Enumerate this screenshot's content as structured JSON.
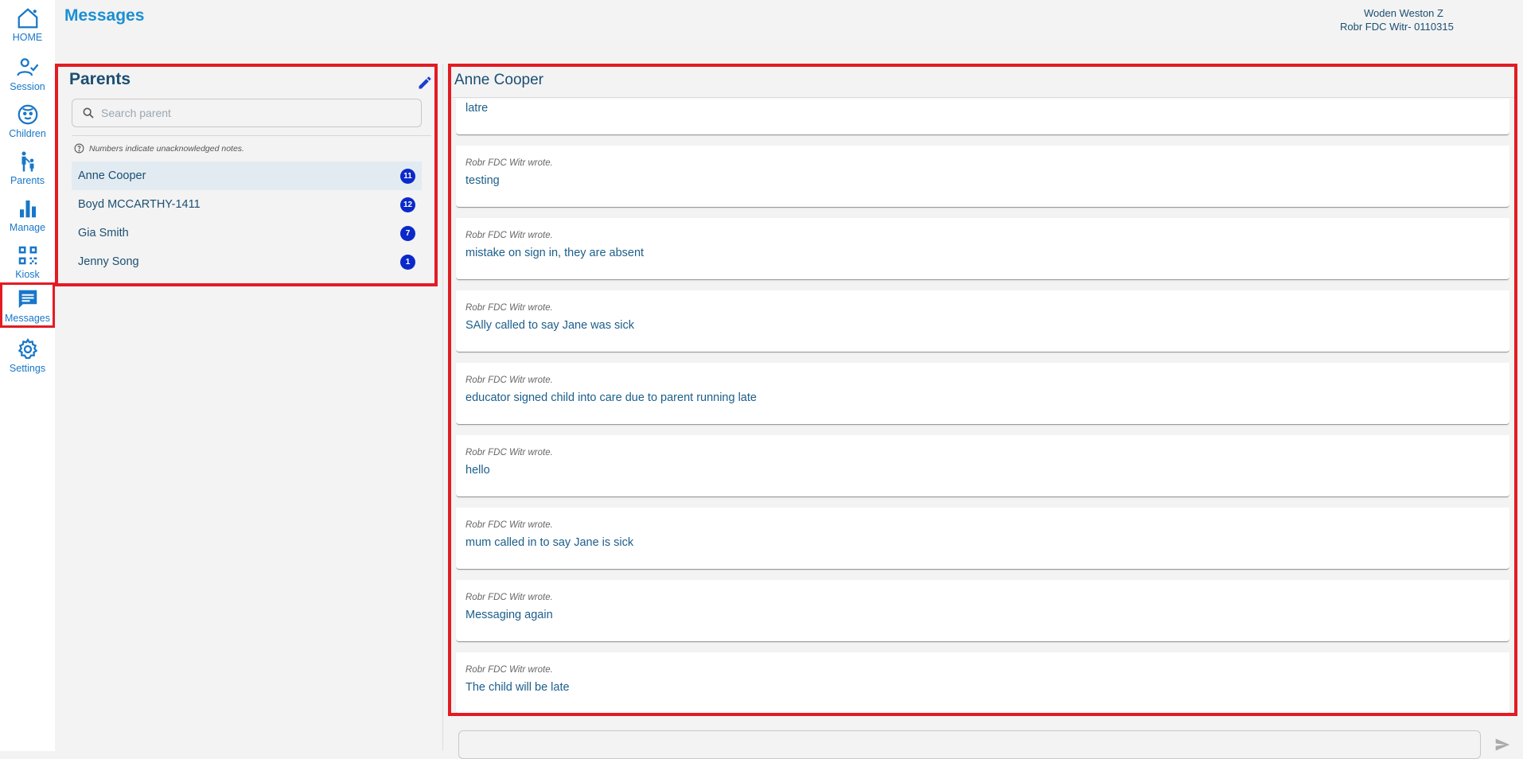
{
  "nav": [
    {
      "key": "home",
      "label": "HOME",
      "icon": "home-icon"
    },
    {
      "key": "session",
      "label": "Session",
      "icon": "person-check-icon"
    },
    {
      "key": "children",
      "label": "Children",
      "icon": "baby-face-icon"
    },
    {
      "key": "parents",
      "label": "Parents",
      "icon": "parent-child-icon"
    },
    {
      "key": "manage",
      "label": "Manage",
      "icon": "bar-chart-icon"
    },
    {
      "key": "kiosk",
      "label": "Kiosk",
      "icon": "qr-code-icon"
    },
    {
      "key": "messages",
      "label": "Messages",
      "icon": "message-icon",
      "active": true
    },
    {
      "key": "settings",
      "label": "Settings",
      "icon": "gear-icon"
    }
  ],
  "header": {
    "title": "Messages",
    "user_line1": "Woden Weston Z",
    "user_line2": "Robr FDC Witr- 0110315"
  },
  "parents": {
    "title": "Parents",
    "search_placeholder": "Search parent",
    "hint": "Numbers indicate unacknowledged notes.",
    "list": [
      {
        "name": "Anne Cooper",
        "count": "11",
        "selected": true
      },
      {
        "name": "Boyd MCCARTHY-1411",
        "count": "12"
      },
      {
        "name": "Gia Smith",
        "count": "7"
      },
      {
        "name": "Jenny Song",
        "count": "1"
      }
    ]
  },
  "chat": {
    "title": "Anne Cooper",
    "messages": [
      {
        "author": "",
        "text": "latre"
      },
      {
        "author": "Robr FDC Witr wrote.",
        "text": "testing"
      },
      {
        "author": "Robr FDC Witr wrote.",
        "text": "mistake on sign in, they are absent"
      },
      {
        "author": "Robr FDC Witr wrote.",
        "text": "SAlly called to say Jane was sick"
      },
      {
        "author": "Robr FDC Witr wrote.",
        "text": "educator signed child into care due to parent running late"
      },
      {
        "author": "Robr FDC Witr wrote.",
        "text": "hello"
      },
      {
        "author": "Robr FDC Witr wrote.",
        "text": "mum called in to say Jane is sick"
      },
      {
        "author": "Robr FDC Witr wrote.",
        "text": "Messaging again"
      },
      {
        "author": "Robr FDC Witr wrote.",
        "text": "The child will be late"
      }
    ],
    "compose_placeholder": ""
  },
  "colors": {
    "accent": "#1b8fd2",
    "highlight": "#e31b23",
    "badge": "#0b29c9"
  }
}
